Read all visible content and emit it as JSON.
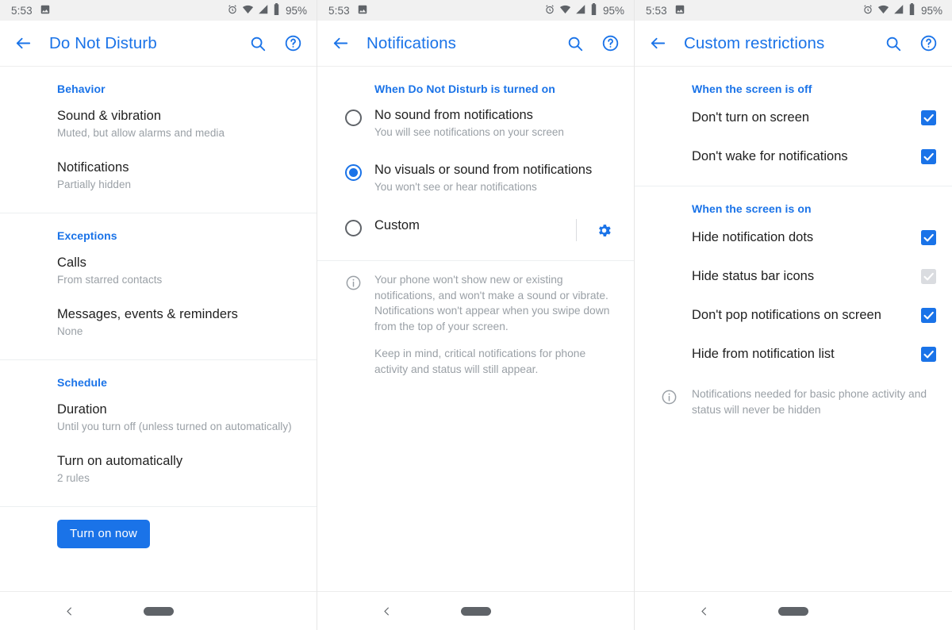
{
  "status_bar": {
    "time": "5:53",
    "battery_pct": "95%",
    "icons": [
      "photo-icon",
      "alarm-icon",
      "wifi-icon",
      "signal-icon",
      "battery-icon"
    ]
  },
  "colors": {
    "accent_blue": "#1a73e8",
    "title_blue": "#1a73e8",
    "primary_text": "#212121",
    "secondary_text": "#9aa0a6",
    "status_bar_bg": "#f1f1f1",
    "disabled_checkbox": "#dadce0"
  },
  "nav_bar": {
    "back_label": "back",
    "home_label": "home"
  },
  "panels": [
    {
      "id": "do-not-disturb",
      "toolbar": {
        "title": "Do Not Disturb",
        "back_icon": "arrow-left-icon",
        "actions": [
          "search-icon",
          "help-icon"
        ]
      },
      "sections": [
        {
          "header": "Behavior",
          "rows": [
            {
              "title": "Sound & vibration",
              "subtitle": "Muted, but allow alarms and media"
            },
            {
              "title": "Notifications",
              "subtitle": "Partially hidden"
            }
          ]
        },
        {
          "header": "Exceptions",
          "rows": [
            {
              "title": "Calls",
              "subtitle": "From starred contacts"
            },
            {
              "title": "Messages, events & reminders",
              "subtitle": "None"
            }
          ]
        },
        {
          "header": "Schedule",
          "rows": [
            {
              "title": "Duration",
              "subtitle": "Until you turn off (unless turned on automatically)"
            },
            {
              "title": "Turn on automatically",
              "subtitle": "2 rules"
            }
          ]
        }
      ],
      "turn_on_button": "Turn on now"
    },
    {
      "id": "notifications",
      "toolbar": {
        "title": "Notifications",
        "back_icon": "arrow-left-icon",
        "actions": [
          "search-icon",
          "help-icon"
        ]
      },
      "section_header": "When Do Not Disturb is turned on",
      "options": [
        {
          "title": "No sound from notifications",
          "subtitle": "You will see notifications on your screen",
          "selected": false,
          "has_settings": false
        },
        {
          "title": "No visuals or sound from notifications",
          "subtitle": "You won't see or hear notifications",
          "selected": true,
          "has_settings": false
        },
        {
          "title": "Custom",
          "subtitle": "",
          "selected": false,
          "has_settings": true
        }
      ],
      "info": {
        "icon": "info-icon",
        "paragraphs": [
          "Your phone won't show new or existing notifications, and won't make a sound or vibrate. Notifications won't appear when you swipe down from the top of your screen.",
          "Keep in mind, critical notifications for phone activity and status will still appear."
        ]
      }
    },
    {
      "id": "custom-restrictions",
      "toolbar": {
        "title": "Custom restrictions",
        "back_icon": "arrow-left-icon",
        "actions": [
          "search-icon",
          "help-icon"
        ]
      },
      "groups": [
        {
          "header": "When the screen is off",
          "items": [
            {
              "label": "Don't turn on screen",
              "checked": true,
              "disabled": false
            },
            {
              "label": "Don't wake for notifications",
              "checked": true,
              "disabled": false
            }
          ]
        },
        {
          "header": "When the screen is on",
          "items": [
            {
              "label": "Hide notification dots",
              "checked": true,
              "disabled": false
            },
            {
              "label": "Hide status bar icons",
              "checked": true,
              "disabled": true
            },
            {
              "label": "Don't pop notifications on screen",
              "checked": true,
              "disabled": false
            },
            {
              "label": "Hide from notification list",
              "checked": true,
              "disabled": false
            }
          ]
        }
      ],
      "info": {
        "icon": "info-icon",
        "paragraphs": [
          "Notifications needed for basic phone activity and status will never be hidden"
        ]
      }
    }
  ]
}
